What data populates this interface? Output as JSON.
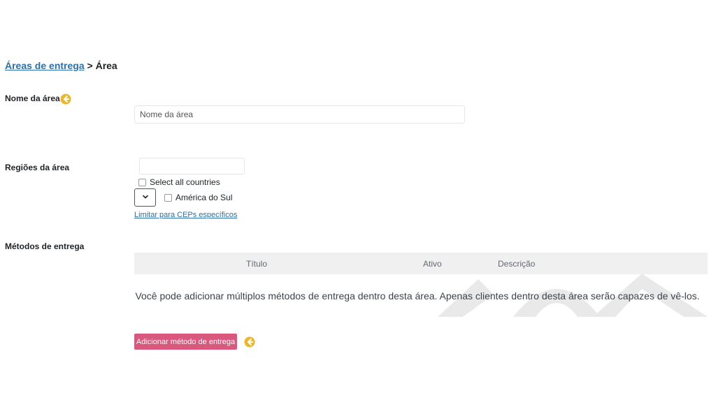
{
  "breadcrumb": {
    "parent": "Áreas de entrega",
    "separator": ">",
    "current": "Área"
  },
  "area_name": {
    "label": "Nome da área",
    "placeholder": "Nome da área",
    "value": ""
  },
  "regions": {
    "label": "Regiões da área",
    "search_value": "",
    "select_all_label": "Select all countries",
    "items": [
      {
        "label": "América do Sul",
        "checked": false
      }
    ],
    "zip_link": "Limitar para CEPs específicos"
  },
  "methods": {
    "label": "Métodos de entrega",
    "columns": [
      "Título",
      "Ativo",
      "Descrição"
    ],
    "empty_message": "Você pode adicionar múltiplos métodos de entrega dentro desta área. Apenas clientes dentro desta área serão capazes de vê-los.",
    "add_button": "Adicionar método de entrega"
  },
  "colors": {
    "link": "#2a6fb0",
    "button": "#d9587d",
    "hint_icon": "#f0b429",
    "table_header": "#f0f0f0"
  },
  "icons": {
    "hint": "arrow-left-circle-icon",
    "dropdown": "chevron-down-icon"
  }
}
